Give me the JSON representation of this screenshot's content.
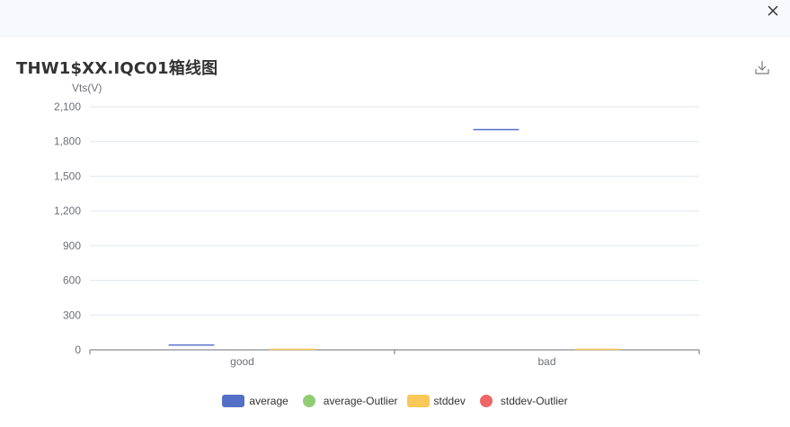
{
  "header": {
    "close_icon": "close-icon",
    "download_icon": "download-icon"
  },
  "chart_data": {
    "type": "boxplot",
    "title": "THW1$XX.IQC01箱线图",
    "ylabel": "Vts(V)",
    "xlabel": "",
    "categories": [
      "good",
      "bad"
    ],
    "ylim": [
      0,
      2100
    ],
    "yticks": [
      0,
      300,
      600,
      900,
      1200,
      1500,
      1800,
      2100
    ],
    "ytick_labels": [
      "0",
      "300",
      "600",
      "900",
      "1,200",
      "1,500",
      "1,800",
      "2,100"
    ],
    "grid": true,
    "legend_position": "bottom-center",
    "series": [
      {
        "name": "average",
        "type": "boxplot",
        "color": "#5470c6",
        "values": [
          42,
          1902
        ]
      },
      {
        "name": "average-Outlier",
        "type": "scatter",
        "color": "#91cc75",
        "values": []
      },
      {
        "name": "stddev",
        "type": "boxplot",
        "color": "#fac858",
        "values": [
          5,
          5
        ]
      },
      {
        "name": "stddev-Outlier",
        "type": "scatter",
        "color": "#ee6666",
        "values": []
      }
    ]
  }
}
